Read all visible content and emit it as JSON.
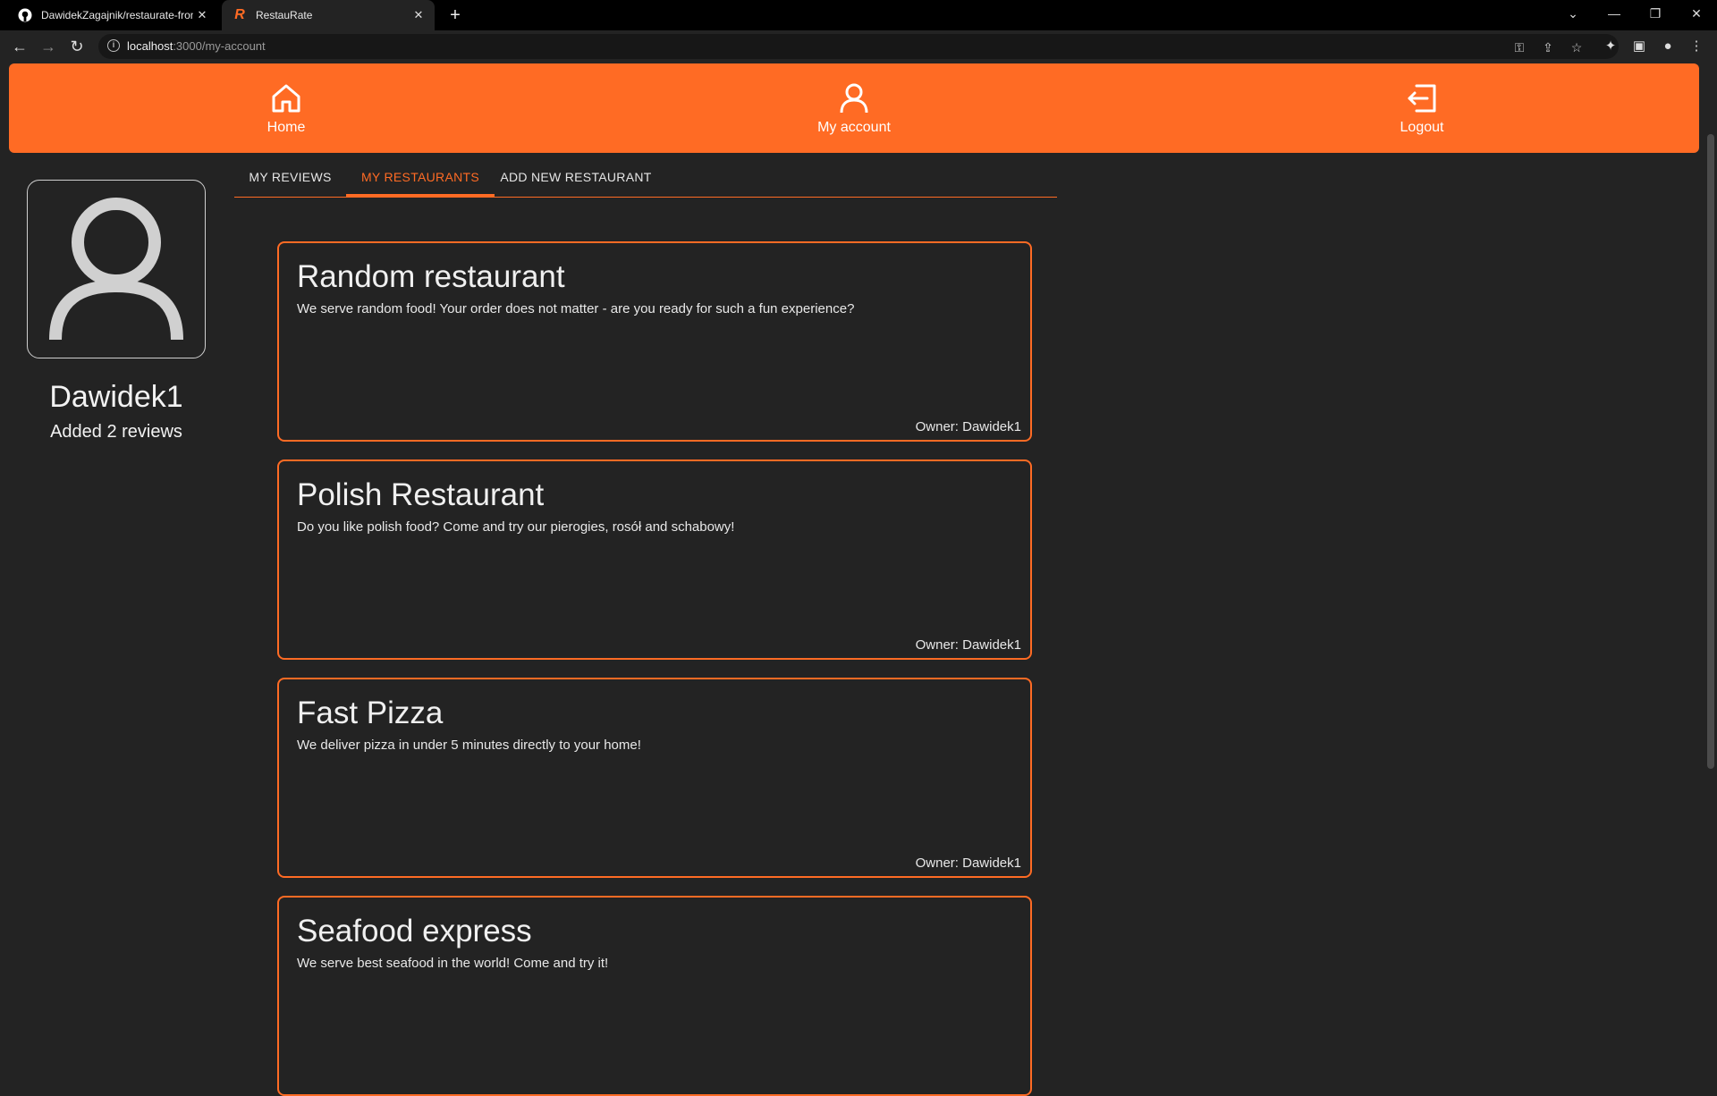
{
  "browser": {
    "tabs": [
      {
        "title": "DawidekZagajnik/restaurate-fron",
        "active": false,
        "favicon": "github-icon"
      },
      {
        "title": "RestauRate",
        "active": true,
        "favicon": "restaurate-logo-icon"
      }
    ],
    "url_host": "localhost",
    "url_path": ":3000/my-account"
  },
  "nav": {
    "items": [
      {
        "label": "Home",
        "icon": "home-icon"
      },
      {
        "label": "My account",
        "icon": "user-icon"
      },
      {
        "label": "Logout",
        "icon": "logout-icon"
      }
    ]
  },
  "profile": {
    "username": "Dawidek1",
    "reviews_text": "Added 2 reviews"
  },
  "tabs": [
    {
      "label": "MY REVIEWS",
      "active": false
    },
    {
      "label": "MY RESTAURANTS",
      "active": true
    },
    {
      "label": "ADD NEW RESTAURANT",
      "active": false
    }
  ],
  "restaurants": [
    {
      "name": "Random restaurant",
      "description": "We serve random food! Your order does not matter - are you ready for such a fun experience?",
      "owner": "Owner: Dawidek1"
    },
    {
      "name": "Polish Restaurant",
      "description": "Do you like polish food? Come and try our pierogies, rosół and schabowy!",
      "owner": "Owner: Dawidek1"
    },
    {
      "name": "Fast Pizza",
      "description": "We deliver pizza in under 5 minutes directly to your home!",
      "owner": "Owner: Dawidek1"
    },
    {
      "name": "Seafood express",
      "description": "We serve best seafood in the world! Come and try it!",
      "owner": ""
    }
  ],
  "colors": {
    "accent": "#ff6b24",
    "background": "#232323"
  }
}
